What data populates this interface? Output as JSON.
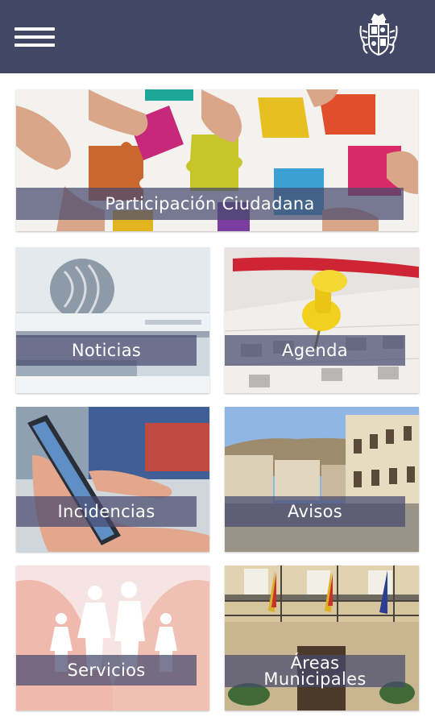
{
  "header": {
    "menu_icon": "hamburger-menu-icon",
    "logo_icon": "coat-of-arms-crest",
    "bar_color": "#434766"
  },
  "tiles": {
    "participacion": {
      "label": "Participación Ciudadana"
    },
    "noticias": {
      "label": "Noticias"
    },
    "agenda": {
      "label": "Agenda"
    },
    "incidencias": {
      "label": "Incidencias"
    },
    "avisos": {
      "label": "Avisos"
    },
    "servicios": {
      "label": "Servicios"
    },
    "areas": {
      "label_line1": "Áreas",
      "label_line2": "Municipales"
    }
  },
  "label_overlay_color": "#464a6e"
}
